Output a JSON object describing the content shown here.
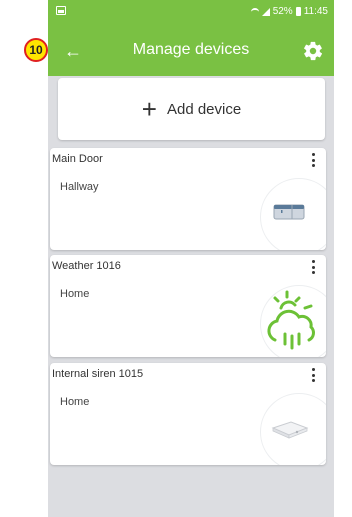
{
  "status_bar": {
    "battery": "52%",
    "time": "11:45"
  },
  "app_bar": {
    "title": "Manage devices"
  },
  "add_device": {
    "plus": "+",
    "label": "Add device"
  },
  "devices": [
    {
      "name": "Main Door",
      "location": "Hallway",
      "icon": "door-sensor-icon"
    },
    {
      "name": "Weather 1016",
      "location": "Home",
      "icon": "weather-icon"
    },
    {
      "name": "Internal siren 1015",
      "location": "Home",
      "icon": "siren-icon"
    }
  ],
  "badge": {
    "number": "10"
  },
  "colors": {
    "accent": "#7ac143",
    "background": "#dcdde1",
    "badge_fill": "#ffe500",
    "badge_border": "#e02020"
  }
}
